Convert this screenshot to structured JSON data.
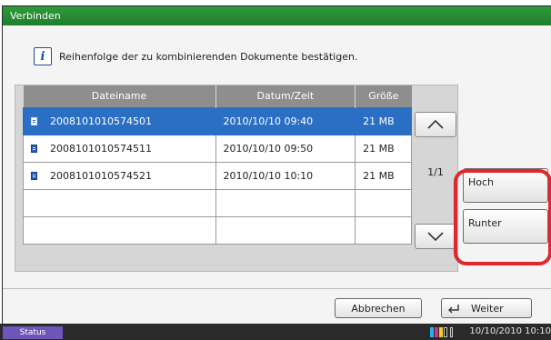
{
  "window": {
    "title": "Verbinden"
  },
  "info": {
    "icon": "info-icon",
    "text": "Reihenfolge der zu kombinierenden Dokumente bestätigen."
  },
  "table": {
    "headers": {
      "name": "Dateiname",
      "date": "Datum/Zeit",
      "size": "Größe"
    },
    "rows": [
      {
        "name": "2008101010574501",
        "date": "2010/10/10  09:40",
        "size": "21 MB",
        "selected": true
      },
      {
        "name": "2008101010574511",
        "date": "2010/10/10  09:50",
        "size": "21 MB",
        "selected": false
      },
      {
        "name": "2008101010574521",
        "date": "2010/10/10  10:10",
        "size": "21 MB",
        "selected": false
      }
    ]
  },
  "pagination": {
    "indicator": "1/1"
  },
  "side_buttons": {
    "up_label": "Hoch",
    "down_label": "Runter"
  },
  "footer": {
    "cancel_label": "Abbrechen",
    "next_label": "Weiter"
  },
  "statusbar": {
    "status_label": "Status",
    "datetime": "10/10/2010  10:10"
  },
  "colors": {
    "accent": "#1f7f2b",
    "selection": "#2b6fc4",
    "highlight": "#e0262e",
    "status": "#6e55b8"
  }
}
